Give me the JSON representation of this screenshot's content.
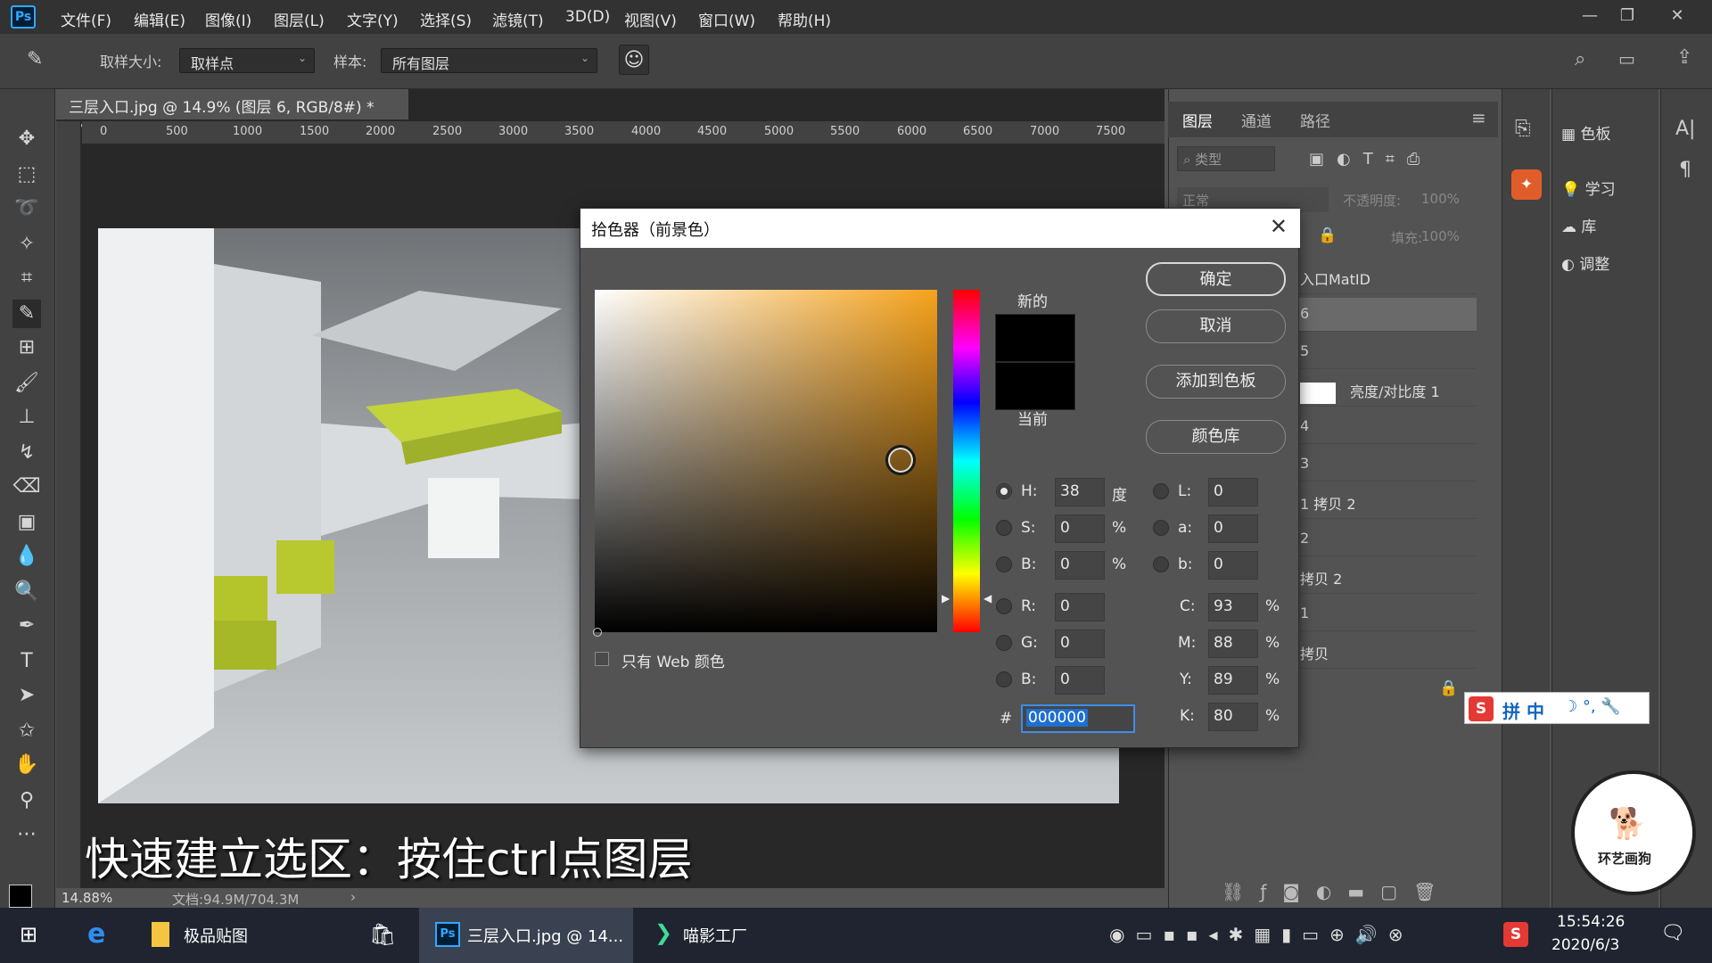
{
  "menu": {
    "app_icon": "Ps",
    "items": [
      "文件(F)",
      "编辑(E)",
      "图像(I)",
      "图层(L)",
      "文字(Y)",
      "选择(S)",
      "滤镜(T)",
      "3D(D)",
      "视图(V)",
      "窗口(W)",
      "帮助(H)"
    ]
  },
  "options": {
    "sample_size_label": "取样大小:",
    "sample_size_value": "取样点",
    "sample_label": "样本:",
    "sample_value": "所有图层"
  },
  "document": {
    "tab_title": "三层入口.jpg @ 14.9% (图层 6, RGB/8#) *",
    "ruler_ticks": [
      "0",
      "500",
      "1000",
      "1500",
      "2000",
      "2500",
      "3000",
      "3500",
      "4000",
      "4500",
      "5000",
      "5500",
      "6000",
      "6500",
      "7000",
      "7500"
    ],
    "zoom": "14.88%",
    "doc_info": "文档:94.9M/704.3M"
  },
  "subtitle": "快速建立选区：按住ctrl点图层",
  "layers": {
    "tabs": [
      "图层",
      "通道",
      "路径"
    ],
    "search_placeholder": "类型",
    "blend_mode": "正常",
    "opacity_label": "不透明度:",
    "opacity_value": "100%",
    "fill_label": "填充:",
    "fill_value": "100%",
    "rows": [
      "入口MatID",
      "6",
      "5",
      "亮度/对比度 1",
      "4",
      "3",
      "1 拷贝 2",
      "2",
      "拷贝 2",
      "1",
      "拷贝"
    ]
  },
  "library_panel": {
    "items": [
      "色板",
      "学习",
      "库",
      "调整"
    ]
  },
  "ime": {
    "label": "拼 中"
  },
  "watermark": {
    "text": "环艺画狗"
  },
  "color_picker": {
    "title": "拾色器（前景色）",
    "new_label": "新的",
    "current_label": "当前",
    "ok": "确定",
    "cancel": "取消",
    "add_swatch": "添加到色板",
    "color_libraries": "颜色库",
    "web_only": "只有 Web 颜色",
    "new_color": "#000000",
    "current_color": "#000000",
    "hue_hex": "#f6a21b",
    "fields": {
      "H": {
        "label": "H:",
        "value": "38",
        "unit": "度"
      },
      "S": {
        "label": "S:",
        "value": "0",
        "unit": "%"
      },
      "B": {
        "label": "B:",
        "value": "0",
        "unit": "%"
      },
      "R": {
        "label": "R:",
        "value": "0"
      },
      "G": {
        "label": "G:",
        "value": "0"
      },
      "B2": {
        "label": "B:",
        "value": "0"
      },
      "L": {
        "label": "L:",
        "value": "0"
      },
      "a": {
        "label": "a:",
        "value": "0"
      },
      "b": {
        "label": "b:",
        "value": "0"
      },
      "C": {
        "label": "C:",
        "value": "93",
        "unit": "%"
      },
      "M": {
        "label": "M:",
        "value": "88",
        "unit": "%"
      },
      "Y": {
        "label": "Y:",
        "value": "89",
        "unit": "%"
      },
      "K": {
        "label": "K:",
        "value": "80",
        "unit": "%"
      }
    },
    "hex_label": "#",
    "hex_value": "000000"
  },
  "taskbar": {
    "items": [
      "极品贴图",
      "三层入口.jpg @ 14...",
      "喵影工厂"
    ],
    "time": "15:54:26",
    "date": "2020/6/3"
  }
}
